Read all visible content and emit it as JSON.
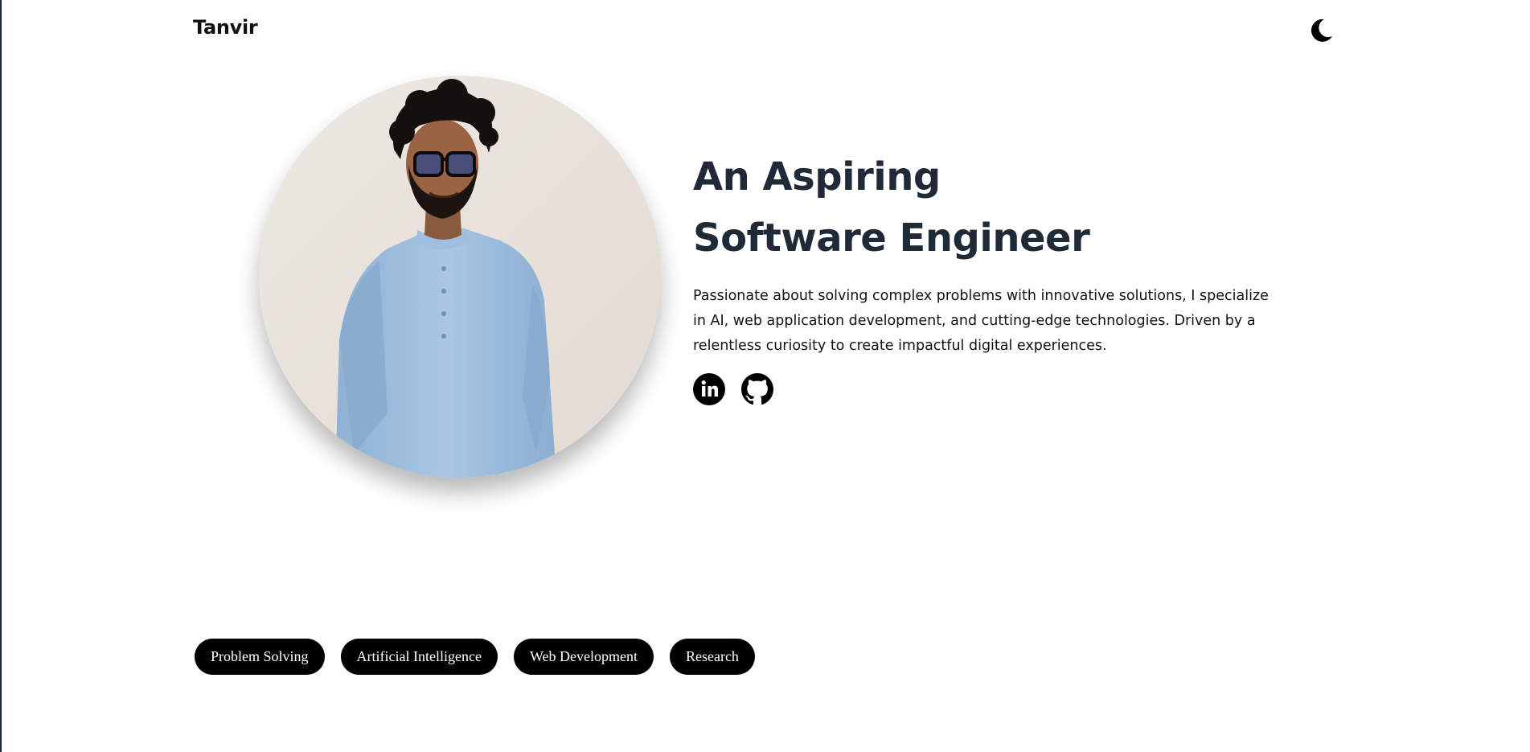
{
  "header": {
    "brand": "Tanvir",
    "theme_toggle_icon": "moon-icon"
  },
  "hero": {
    "title_line1": "An Aspiring",
    "title_line2": "Software Engineer",
    "description": "Passionate about solving complex problems with innovative solutions, I specialize in AI, web application development, and cutting-edge technologies. Driven by a relentless curiosity to create impactful digital experiences.",
    "social": [
      {
        "icon": "linkedin-icon"
      },
      {
        "icon": "github-icon"
      }
    ]
  },
  "skills": [
    "Problem Solving",
    "Artificial Intelligence",
    "Web Development",
    "Research"
  ],
  "colors": {
    "text": "#1f2937",
    "pill_bg": "#000000",
    "pill_text": "#ffffff",
    "background": "#ffffff"
  }
}
